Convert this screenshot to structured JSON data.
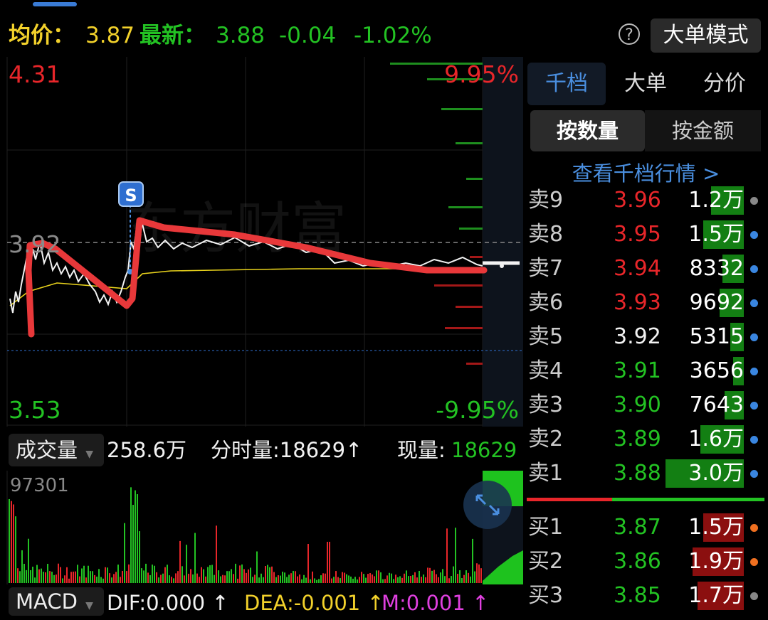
{
  "header": {
    "avg_label": "均价：",
    "avg_value": "3.87",
    "latest_label": "最新：",
    "latest_value": "3.88",
    "change": "-0.04",
    "change_pct": "-1.02%",
    "help_icon": "?",
    "mode_button": "大单模式"
  },
  "chart": {
    "price_high": "4.31",
    "price_mid": "3.92",
    "price_low": "3.53",
    "pct_high": "9.95%",
    "pct_low": "-9.95%",
    "marker": "S",
    "watermark": "东方财富"
  },
  "volume": {
    "selector_label": "成交量",
    "total": "258.6万",
    "minute_volume": "分时量:18629↑",
    "current_label": "现量:",
    "current_value": "18629",
    "axis_max": "97301"
  },
  "macd": {
    "selector_label": "MACD",
    "dif": "DIF:0.000 ↑",
    "dea": "DEA:-0.001 ↑",
    "m": "M:0.001 ↑"
  },
  "right_panel": {
    "tabs": [
      "千档",
      "大单",
      "分价"
    ],
    "segments": [
      "按数量",
      "按金额"
    ],
    "view_link": "查看千档行情 >",
    "sell_rows": [
      {
        "label": "卖9",
        "price": "3.96",
        "volume": "1.2万",
        "level": 0.12
      },
      {
        "label": "卖8",
        "price": "3.95",
        "volume": "1.5万",
        "level": 0.15
      },
      {
        "label": "卖7",
        "price": "3.94",
        "volume": "8332",
        "level": 0.08
      },
      {
        "label": "卖6",
        "price": "3.93",
        "volume": "9692",
        "level": 0.09
      },
      {
        "label": "卖5",
        "price": "3.92",
        "volume": "5315",
        "level": 0.05
      },
      {
        "label": "卖4",
        "price": "3.91",
        "volume": "3656",
        "level": 0.04
      },
      {
        "label": "卖3",
        "price": "3.90",
        "volume": "7643",
        "level": 0.07
      },
      {
        "label": "卖2",
        "price": "3.89",
        "volume": "1.6万",
        "level": 0.16
      },
      {
        "label": "卖1",
        "price": "3.88",
        "volume": "3.0万",
        "level": 0.29
      }
    ],
    "buy_rows": [
      {
        "label": "买1",
        "price": "3.87",
        "volume": "1.5万",
        "level": 0.15
      },
      {
        "label": "买2",
        "price": "3.86",
        "volume": "1.9万",
        "level": 0.19
      },
      {
        "label": "买3",
        "price": "3.85",
        "volume": "1.7万",
        "level": 0.17
      }
    ],
    "colors": {
      "up": "#e8262a",
      "down": "#23c223",
      "flat": "#f2f2f2",
      "accent": "#4a8fe0"
    }
  }
}
